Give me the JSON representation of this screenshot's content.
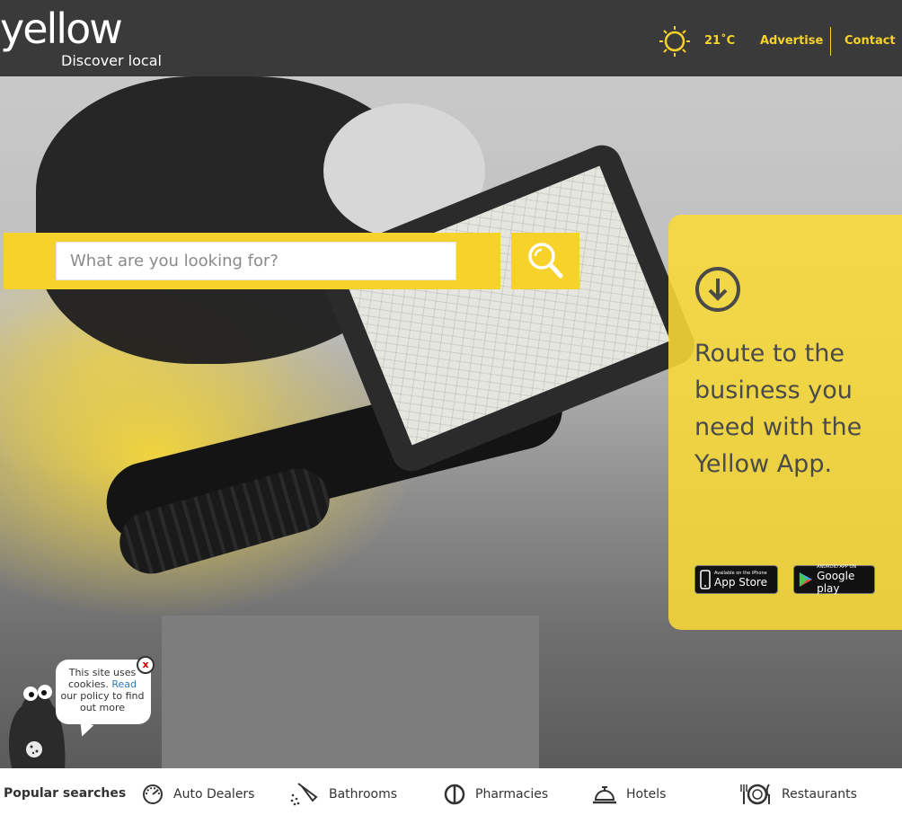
{
  "header": {
    "logo_text": "yellow",
    "tagline": "Discover local",
    "weather": {
      "icon": "sun-icon",
      "temperature": "21˚C"
    },
    "nav": [
      {
        "label": "Advertise"
      },
      {
        "label": "Contact"
      }
    ]
  },
  "search": {
    "placeholder": "What are you looking for?",
    "button_icon": "search-icon"
  },
  "app_promo": {
    "icon": "download-icon",
    "text": "Route to the business you need with the Yellow App.",
    "app_store": {
      "small": "Available on the iPhone",
      "big": "App Store"
    },
    "google_play": {
      "small": "ANDROID APP ON",
      "big": "Google play"
    }
  },
  "cookie": {
    "text_before": "This site uses cookies.",
    "link": "Read",
    "text_after": "our policy to find out more",
    "close": "x"
  },
  "popular_searches": {
    "title": "Popular searches",
    "items": [
      {
        "label": "Auto Dealers",
        "icon": "car-gauge-icon"
      },
      {
        "label": "Bathrooms",
        "icon": "shower-icon"
      },
      {
        "label": "Pharmacies",
        "icon": "pill-icon"
      },
      {
        "label": "Hotels",
        "icon": "service-bell-icon"
      },
      {
        "label": "Restaurants",
        "icon": "cutlery-icon"
      }
    ]
  },
  "colors": {
    "brand_yellow": "#f6d22b",
    "header_bg": "#3a3a3a",
    "panel_text": "#4a4a4a"
  }
}
